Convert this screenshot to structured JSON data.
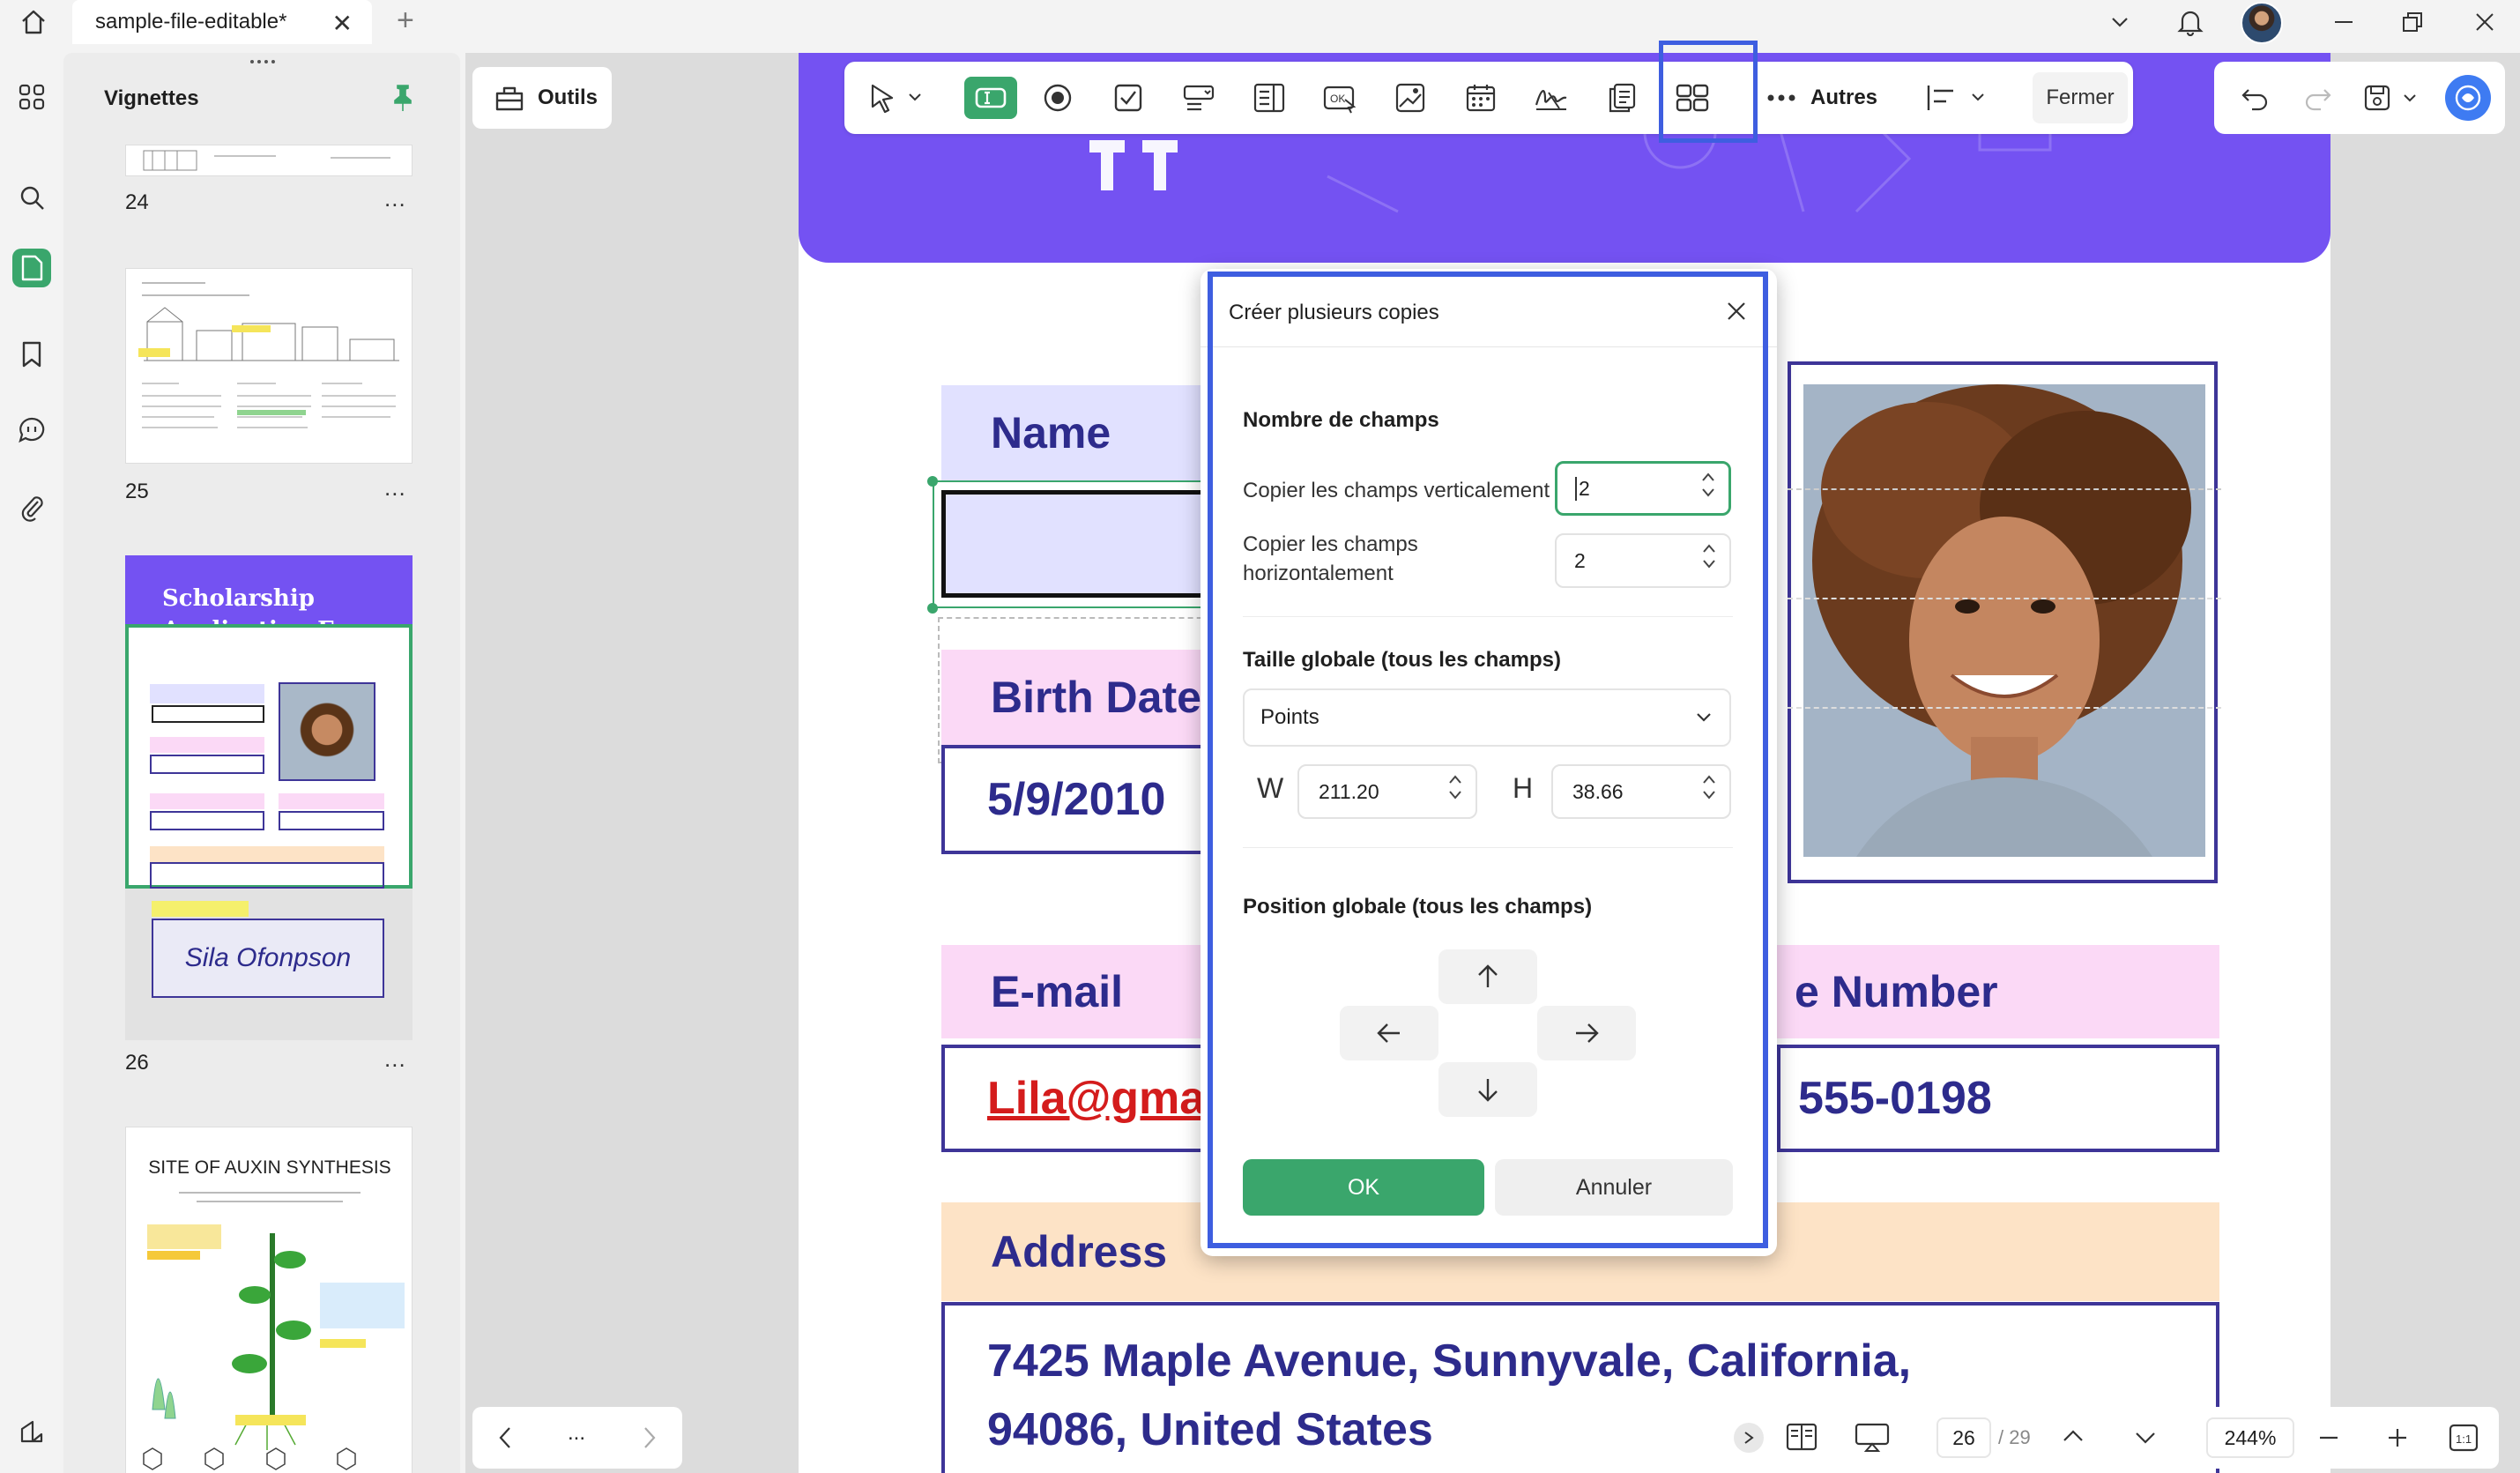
{
  "titlebar": {
    "tab_label": "sample-file-editable*",
    "close_glyph": "✕",
    "new_tab_glyph": "+"
  },
  "sidebar": {
    "title": "Vignettes",
    "pages": [
      {
        "number": "24",
        "more": "..."
      },
      {
        "number": "25",
        "more": "..."
      },
      {
        "number": "26",
        "more": "..."
      }
    ],
    "thumb26": {
      "title_line1": "Scholarship",
      "title_line2": "Application Form",
      "signature": "Sila Ofonpson"
    },
    "thumb27": {
      "title": "SITE OF AUXIN SYNTHESIS"
    }
  },
  "tools": {
    "label": "Outils"
  },
  "toolbar": {
    "more_label": "Autres",
    "close_label": "Fermer"
  },
  "document": {
    "fields": {
      "name_label": "Name",
      "birth_label": "Birth Date",
      "birth_value": "5/9/2010",
      "email_label": "E-mail",
      "email_value": "Lila@gma",
      "phone_label": "e Number",
      "phone_value": "555-0198",
      "address_label": "Address",
      "address_line1": "7425 Maple Avenue, Sunnyvale, California,",
      "address_line2": "94086, United States"
    }
  },
  "dialog": {
    "title": "Créer plusieurs copies",
    "section_count": "Nombre de champs",
    "copy_vertical_label": "Copier les champs verticalement",
    "copy_vertical_value": "2",
    "copy_horizontal_label_1": "Copier les champs",
    "copy_horizontal_label_2": "horizontalement",
    "copy_horizontal_value": "2",
    "section_size": "Taille globale (tous les champs)",
    "unit_value": "Points",
    "w_label": "W",
    "w_value": "211.20",
    "h_label": "H",
    "h_value": "38.66",
    "section_position": "Position globale (tous les champs)",
    "ok_label": "OK",
    "cancel_label": "Annuler"
  },
  "bottom": {
    "current_page": "26",
    "total_pages": "/ 29",
    "zoom": "244%",
    "more": "..."
  },
  "colors": {
    "accent_green": "#3aa66c",
    "highlight_blue": "#3e5ee0",
    "banner_purple": "#7452f2"
  }
}
